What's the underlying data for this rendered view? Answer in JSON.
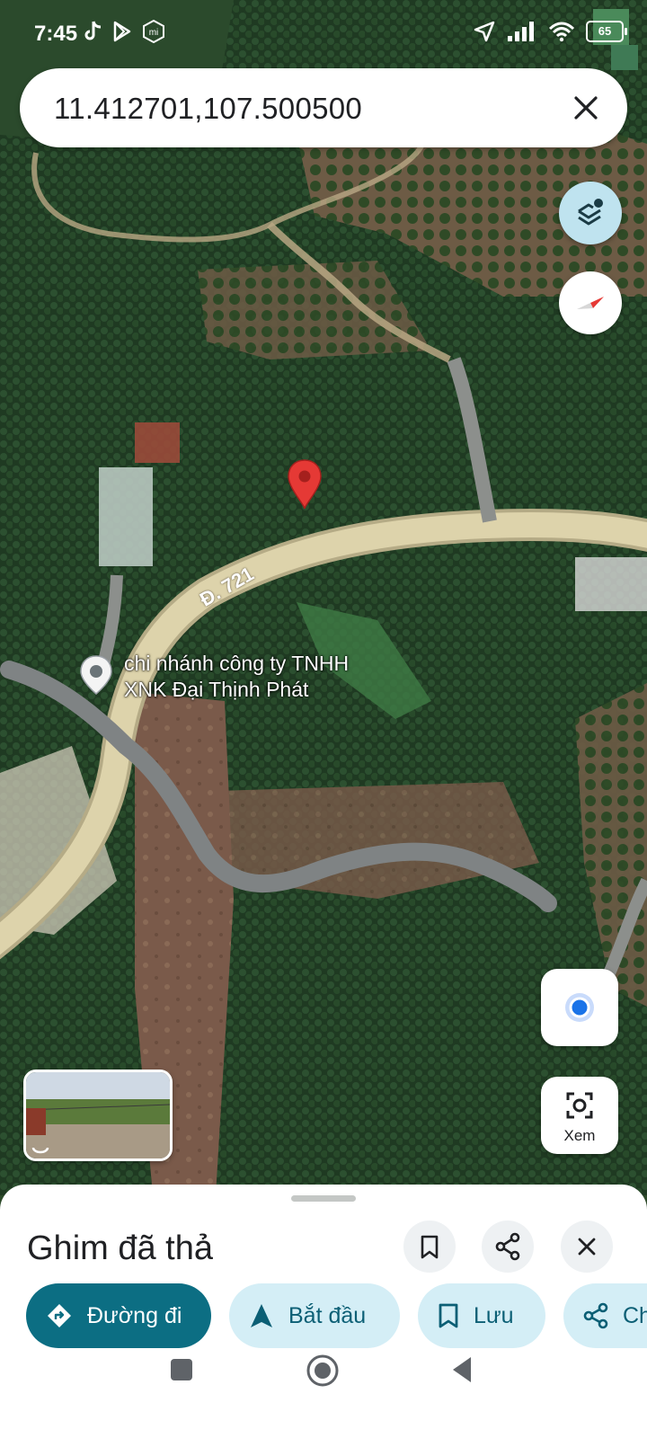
{
  "status_bar": {
    "time": "7:45",
    "battery": "65"
  },
  "search": {
    "query": "11.412701,107.500500"
  },
  "map": {
    "road_label": "Đ. 721",
    "place": {
      "line1": "chi nhánh công ty TNHH",
      "line2": "XNK Đại Thịnh Phát"
    }
  },
  "controls": {
    "explore_label": "Xem"
  },
  "sheet": {
    "title": "Ghim đã thả",
    "chips": [
      {
        "label": "Đường đi",
        "icon": "directions-icon"
      },
      {
        "label": "Bắt đầu",
        "icon": "navigation-icon"
      },
      {
        "label": "Lưu",
        "icon": "bookmark-icon"
      },
      {
        "label": "Chia sẻ",
        "icon": "share-icon"
      }
    ]
  },
  "colors": {
    "accent": "#0c6e83",
    "chip_bg": "#d4eef6",
    "pin": "#e53935",
    "road": "#d9cfa6"
  }
}
